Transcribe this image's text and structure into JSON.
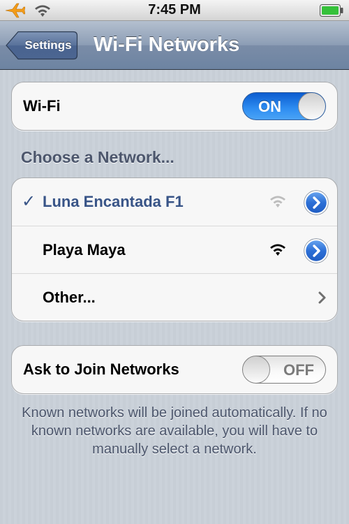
{
  "status_bar": {
    "time": "7:45 PM",
    "left_icons": [
      "airplane-icon",
      "wifi-icon"
    ],
    "right_icons": [
      "battery-icon"
    ]
  },
  "nav": {
    "back_label": "Settings",
    "title": "Wi-Fi Networks"
  },
  "wifi_toggle": {
    "label": "Wi-Fi",
    "state": "ON"
  },
  "section_header": "Choose a Network...",
  "networks": [
    {
      "name": "Luna Encantada F1",
      "selected": true,
      "checkmark": "✓",
      "signal_color": "#bdbdbd"
    },
    {
      "name": "Playa Maya",
      "selected": false,
      "signal_color": "#000000"
    }
  ],
  "other_label": "Other...",
  "ask_to_join": {
    "label": "Ask to Join Networks",
    "state": "OFF"
  },
  "footer": "Known networks will be joined automatically.  If no known networks are available, you will have to manually select a network.",
  "colors": {
    "accent_blue": "#2f8ef2",
    "selected_text": "#385487",
    "nav_bar": "#6d84a2",
    "background": "#c5ccd4"
  }
}
